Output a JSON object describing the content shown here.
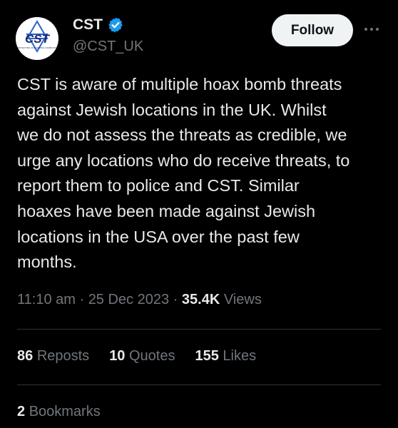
{
  "header": {
    "display_name": "CST",
    "handle": "@CST_UK",
    "follow_label": "Follow",
    "verified_icon": "verified-badge-icon",
    "more_icon": "more-options-icon",
    "avatar_text": "CST",
    "avatar_subtext": "PROTECTING OUR JEWISH COMMUNITY"
  },
  "tweet": {
    "text": "CST is aware of multiple hoax bomb threats\nagainst Jewish locations in the UK. Whilst\nwe do not assess the threats as credible, we\nurge any locations who do receive threats, to\nreport them to police and CST. Similar\nhoaxes have been made against Jewish\nlocations in the USA over the past few\nmonths."
  },
  "meta": {
    "time": "11:10 am",
    "separator": " · ",
    "date": "25 Dec 2023",
    "views_count": "35.4K",
    "views_label": "Views"
  },
  "stats": {
    "reposts_count": "86",
    "reposts_label": "Reposts",
    "quotes_count": "10",
    "quotes_label": "Quotes",
    "likes_count": "155",
    "likes_label": "Likes",
    "bookmarks_count": "2",
    "bookmarks_label": "Bookmarks"
  },
  "colors": {
    "background": "#000000",
    "primary_text": "#e7e9ea",
    "secondary_text": "#71767b",
    "verified_blue": "#1d9bf0",
    "brand_navy": "#1e2a6e",
    "divider": "#2f3336"
  }
}
